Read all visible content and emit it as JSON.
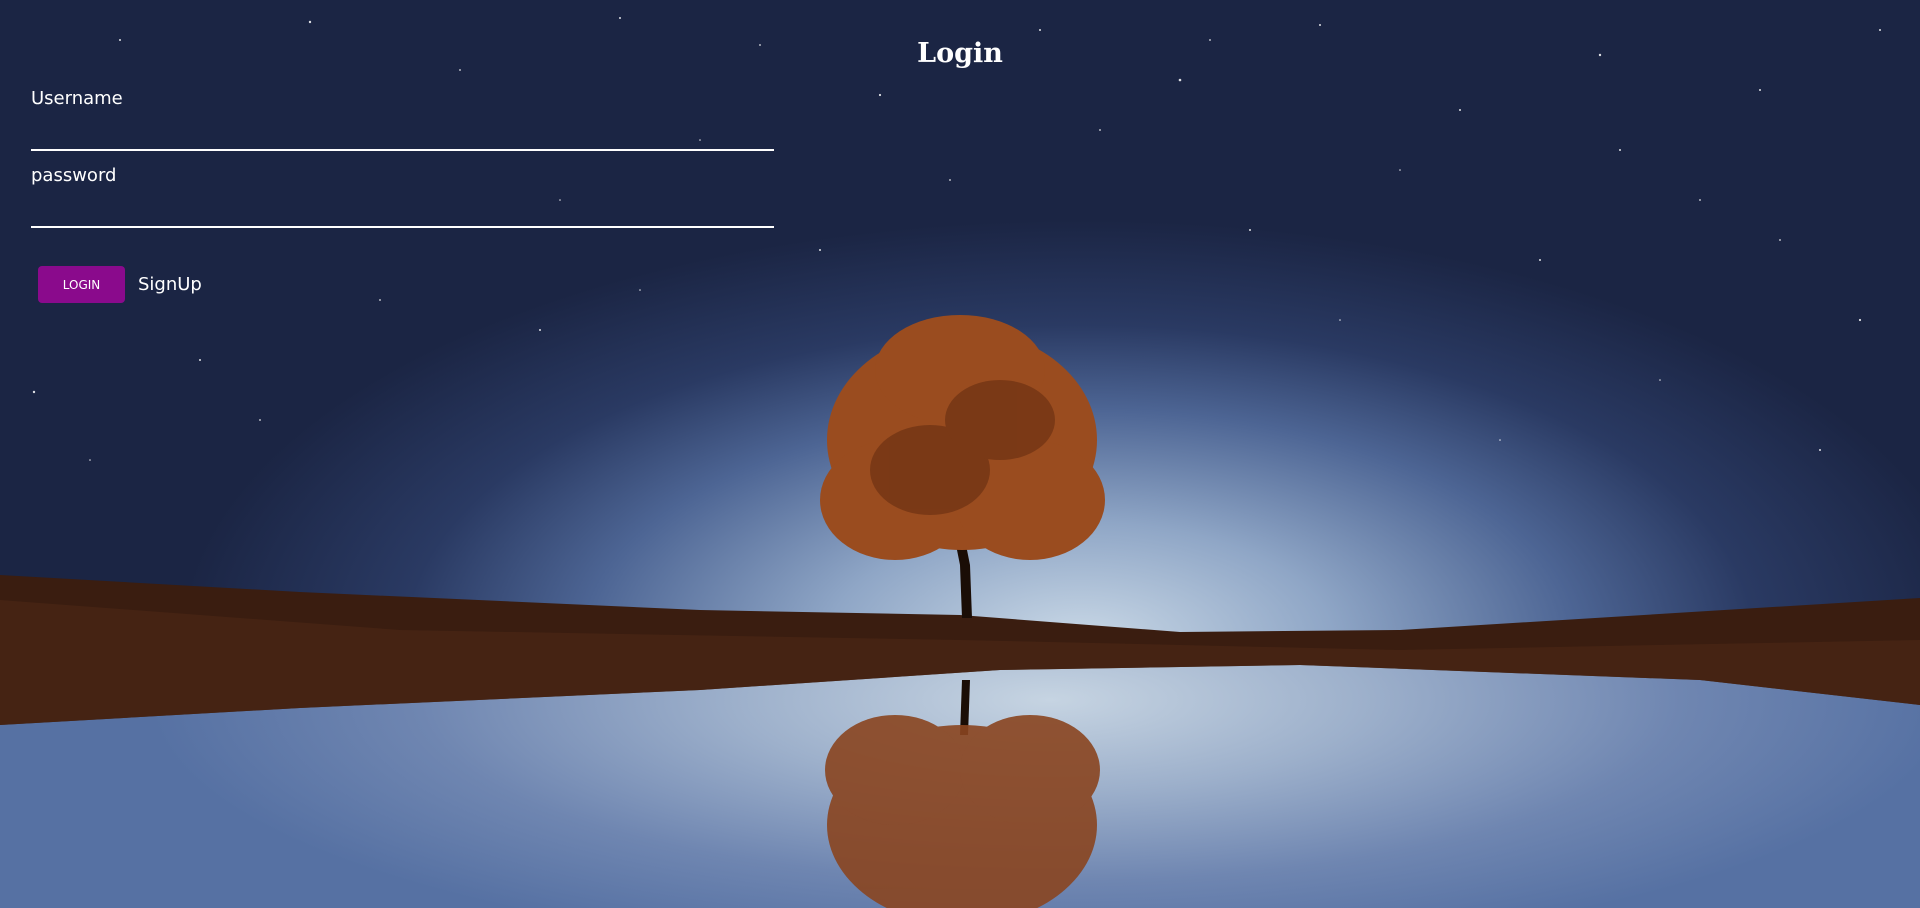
{
  "page": {
    "title": "Login"
  },
  "form": {
    "username_label": "Username",
    "username_value": "",
    "password_label": "password",
    "password_value": ""
  },
  "actions": {
    "login_label": "LOGIN",
    "signup_label": "SignUp"
  },
  "colors": {
    "login_button": "#8a0a8c",
    "text": "#ffffff"
  }
}
